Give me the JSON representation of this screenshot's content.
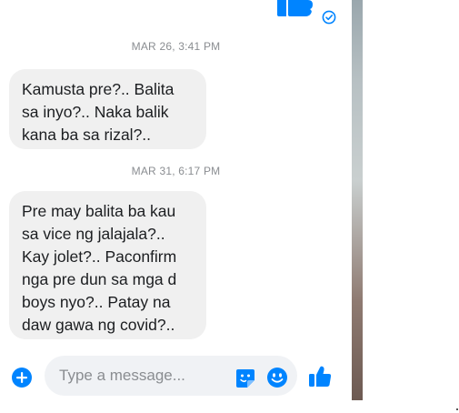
{
  "messages": [
    {
      "timestamp": "MAR 26, 3:41 PM",
      "lines": [
        "Kamusta pre?.. Balita",
        "sa inyo?.. Naka balik",
        "kana ba sa rizal?.."
      ]
    },
    {
      "timestamp": "MAR 31, 6:17 PM",
      "lines": [
        "Pre may balita ba kau",
        "sa vice ng jalajala?..",
        "Kay jolet?.. Paconfirm",
        "nga pre dun sa mga d",
        "boys nyo?.. Patay na",
        "daw gawa ng covid?.."
      ]
    }
  ],
  "composer": {
    "placeholder": "Type a message..."
  },
  "icons": {
    "add": "plus-circle-icon",
    "sticker": "sticker-icon",
    "emoji": "smiley-icon",
    "like": "thumbs-up-icon",
    "read": "check-circle-icon"
  },
  "colors": {
    "accent": "#0084ff",
    "bubble": "#f0f0f0",
    "timestamp": "#8a8d91",
    "input_bg": "#f0f2f5"
  }
}
